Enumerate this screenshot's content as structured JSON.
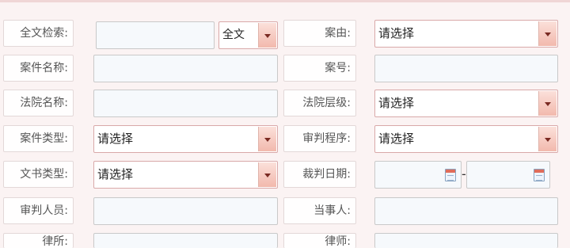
{
  "form": {
    "fulltext_label": "全文检索:",
    "fulltext_value": "",
    "fulltext_scope": "全文",
    "cause_label": "案由:",
    "cause_value": "请选择",
    "case_name_label": "案件名称:",
    "case_no_label": "案号:",
    "court_name_label": "法院名称:",
    "court_level_label": "法院层级:",
    "court_level_value": "请选择",
    "case_type_label": "案件类型:",
    "case_type_value": "请选择",
    "procedure_label": "审判程序:",
    "procedure_value": "请选择",
    "doc_type_label": "文书类型:",
    "doc_type_value": "请选择",
    "judge_date_label": "裁判日期:",
    "date_separator": "-",
    "judge_label": "审判人员:",
    "party_label": "当事人:",
    "law_firm_label": "律所:",
    "lawyer_label": "律师:"
  },
  "icons": {
    "dropdown": "chevron-down-icon",
    "calendar": "calendar-icon"
  },
  "colors": {
    "background": "#fbf3f3",
    "dropdown_arrow": "#f2b9ad",
    "select_border": "#d9a9a9"
  }
}
